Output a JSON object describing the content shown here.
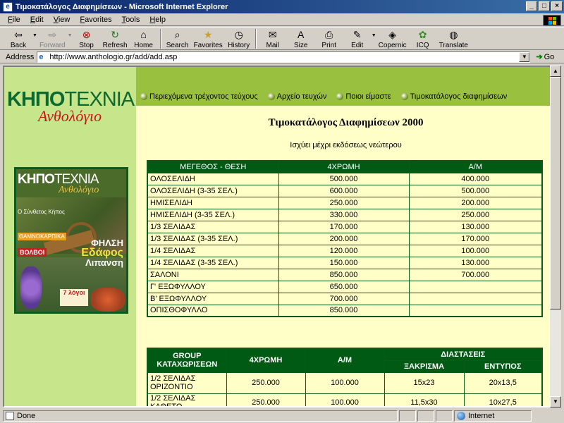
{
  "window": {
    "title": "Τιμοκατάλογος Διαφημίσεων - Microsoft Internet Explorer",
    "app_icon": "ie-page-icon"
  },
  "menu": [
    "File",
    "Edit",
    "View",
    "Favorites",
    "Tools",
    "Help"
  ],
  "toolbar": {
    "back": "Back",
    "forward": "Forward",
    "stop": "Stop",
    "refresh": "Refresh",
    "home": "Home",
    "search": "Search",
    "favorites": "Favorites",
    "history": "History",
    "mail": "Mail",
    "size": "Size",
    "print": "Print",
    "edit": "Edit",
    "copernic": "Copernic",
    "icq": "ICQ",
    "translate": "Translate"
  },
  "address": {
    "label": "Address",
    "url": "http://www.anthologio.gr/add/add.asp",
    "go": "Go"
  },
  "site": {
    "logo_main_bold": "ΚΗΠΟ",
    "logo_main_thin": "ΤΕΧΝΙΑ",
    "logo_script": "Ανθολόγιο",
    "nav": [
      "Περιεχόμενα τρέχοντος τεύχους",
      "Αρχείο τευχών",
      "Ποιοι είμαστε",
      "Τιμοκατάλογος διαφημίσεων"
    ],
    "magazine": {
      "title_bold": "ΚΗΠΟ",
      "title_thin": "ΤΕΧΝΙΑ",
      "script": "Ανθολόγιο",
      "label1": "Ο Σύνθετος Κήπος",
      "label2": "ΘΑΜΝΟΚΑΡΠΙΚΑ",
      "label3": "ΒΟΛΒΟΙ",
      "label4_line1": "ΦΗΛΣΗ",
      "label4_line2": "Εδάφος",
      "label4_line3": "Λιπανση",
      "label5": "7 λόγοι"
    }
  },
  "page": {
    "title": "Τιμοκατάλογος Διαφημίσεων 2000",
    "subtitle": "Ισχύει μέχρι εκδόσεως νεώτερου"
  },
  "table1": {
    "headers": [
      "ΜΕΓΕΘΟΣ - ΘΕΣΗ",
      "4ΧΡΩΜΗ",
      "Α/Μ"
    ],
    "rows": [
      [
        "ΟΛΟΣΕΛΙΔΗ",
        "500.000",
        "400.000"
      ],
      [
        "ΟΛΟΣΕΛΙΔΗ (3-35 ΣΕΛ.)",
        "600.000",
        "500.000"
      ],
      [
        "ΗΜΙΣΕΛΙΔΗ",
        "250.000",
        "200.000"
      ],
      [
        "ΗΜΙΣΕΛΙΔΗ (3-35 ΣΕΛ.)",
        "330.000",
        "250.000"
      ],
      [
        "1/3 ΣΕΛΙΔΑΣ",
        "170.000",
        "130.000"
      ],
      [
        "1/3 ΣΕΛΙΔΑΣ (3-35 ΣΕΛ.)",
        "200.000",
        "170.000"
      ],
      [
        "1/4 ΣΕΛΙΔΑΣ",
        "120.000",
        "100.000"
      ],
      [
        "1/4 ΣΕΛΙΔΑΣ (3-35 ΣΕΛ.)",
        "150.000",
        "130.000"
      ],
      [
        "ΣΑΛΟΝΙ",
        "850.000",
        "700.000"
      ],
      [
        "Γ' ΕΞΩΦΥΛΛΟΥ",
        "650.000",
        ""
      ],
      [
        "Β' ΕΞΩΦΥΛΛΟΥ",
        "700.000",
        ""
      ],
      [
        "ΟΠΙΣΘΟΦΥΛΛΟ",
        "850.000",
        ""
      ]
    ]
  },
  "table2": {
    "headers": {
      "group": "GROUP ΚΑΤΑΧΩΡΙΣΕΩΝ",
      "color": "4ΧΡΩΜΗ",
      "bw": "Α/Μ",
      "dims": "ΔΙΑΣΤΑΣΕΙΣ",
      "bleed": "ΞΑΚΡΙΣΜΑ",
      "print": "ΕΝΤΥΠΟΣ"
    },
    "rows": [
      [
        "1/2 ΣΕΛΙΔΑΣ ΟΡΙΖΟΝΤΙΟ",
        "250.000",
        "100.000",
        "15x23",
        "20x13,5"
      ],
      [
        "1/2 ΣΕΛΙΔΑΣ ΚΑΘΕΤΟ",
        "250.000",
        "100.000",
        "11,5x30",
        "10x27,5"
      ]
    ]
  },
  "status": {
    "text": "Done",
    "zone": "Internet"
  },
  "colors": {
    "page_bg": "#ffffc7",
    "left_col": "#c7e58a",
    "top_band": "#9ac040",
    "table_header": "#005a14",
    "logo_green": "#0a6a30",
    "logo_red": "#c51818"
  }
}
